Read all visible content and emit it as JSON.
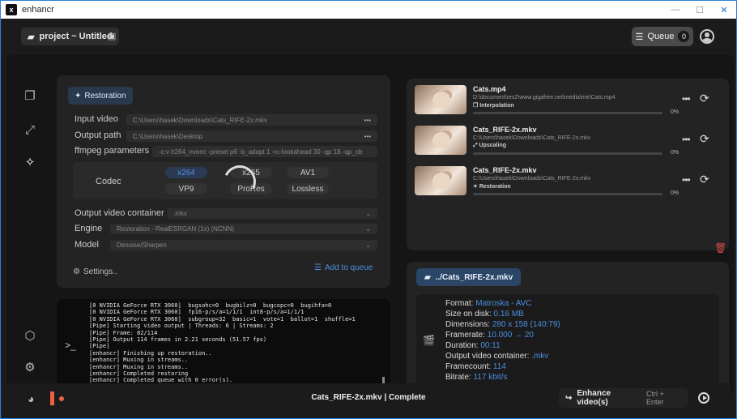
{
  "window": {
    "title": "enhancr",
    "app_icon": "x"
  },
  "topbar": {
    "project_label": "project ~ Untitled",
    "queue_label": "Queue",
    "queue_count": "0"
  },
  "restoration": {
    "tag": "Restoration",
    "input_label": "Input video",
    "input_value": "C:\\Users\\hasek\\Downloads\\Cats_RIFE-2x.mkv",
    "output_label": "Output path",
    "output_value": "C:\\Users\\hasek\\Desktop",
    "ffmpeg_label": "ffmpeg parameters",
    "ffmpeg_value": "-c:v h264_nvenc -preset p6 -b_adapt 1 -rc-lookahead 30 -qp 18 -qp_cb",
    "codec_label": "Codec",
    "codecs": [
      "x264",
      "x265",
      "AV1",
      "VP9",
      "ProRes",
      "Lossless"
    ],
    "container_label": "Output video container",
    "container_value": ".mkv",
    "engine_label": "Engine",
    "engine_value": "Restoration - RealESRGAN (1x) (NCNN)",
    "model_label": "Model",
    "model_value": "Denoise/Sharpen",
    "settings_label": "Settings..",
    "add_queue_label": "Add to queue"
  },
  "console": {
    "lines": "[0 NVIDIA GeForce RTX 3060]  bugsohc=0  bugbilz=0  bugcopc=0  bugihfa=0\n[0 NVIDIA GeForce RTX 3060]  fp16-p/s/a=1/1/1  int8-p/s/a=1/1/1\n[0 NVIDIA GeForce RTX 3060]  subgroup=32  basic=1  vote=1  ballot=1  shuffle=1\n[Pipe] Starting video output | Threads: 6 | Streams: 2\n[Pipe] Frame: 82/114\n[Pipe] Output 114 frames in 2.21 seconds (51.57 fps)\n[Pipe]\n[enhancr] Finishing up restoration..\n[enhancr] Muxing in streams..\n[enhancr] Muxing in streams..\n[enhancr] Completed restoring\n[enhancr] Completed queue with 0 error(s)."
  },
  "queue": [
    {
      "name": "Cats.mp4",
      "path": "D:\\document\\res2\\www.gigafree.net\\media\\me\\Cats.mp4",
      "type": "Interpolation",
      "progress": "0%"
    },
    {
      "name": "Cats_RIFE-2x.mkv",
      "path": "C:\\Users\\hasek\\Downloads\\Cats_RIFE-2x.mkv",
      "type": "Upscaling",
      "progress": "0%"
    },
    {
      "name": "Cats_RIFE-2x.mkv",
      "path": "C:\\Users\\hasek\\Downloads\\Cats_RIFE-2x.mkv",
      "type": "Restoration",
      "progress": "0%"
    }
  ],
  "info": {
    "file_tag": "../Cats_RIFE-2x.mkv",
    "format_label": "Format:",
    "format_value": "Matroska - AVC",
    "size_label": "Size on disk:",
    "size_value": "0.16 MB",
    "dim_label": "Dimensions:",
    "dim_value": "280 x 158 (140:79)",
    "fr_label": "Framerate:",
    "fr_value": "10.000 → 20",
    "dur_label": "Duration:",
    "dur_value": "00:11",
    "cont_label": "Output video container:",
    "cont_value": ".mkv",
    "fc_label": "Framecount:",
    "fc_value": "114",
    "br_label": "Bitrate:",
    "br_value": "117 kbit/s"
  },
  "bottom": {
    "status": "Cats_RIFE-2x.mkv | Complete",
    "enhance_label": "Enhance video(s)",
    "enhance_shortcut": "Ctrl + Enter"
  },
  "colors": {
    "accent": "#4a8fe0",
    "danger": "#d14a4a",
    "patreon": "#e86444"
  }
}
